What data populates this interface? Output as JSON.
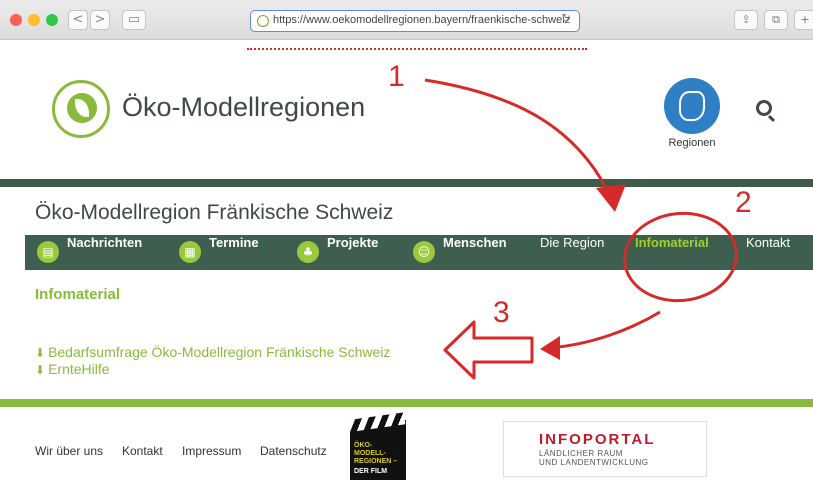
{
  "browser": {
    "url": "https://www.oekomodellregionen.bayern/fraenkische-schweiz",
    "back_glyph": "<",
    "forward_glyph": ">",
    "reload_glyph": "↻"
  },
  "header": {
    "site_title": "Öko-Modellregionen",
    "regions_label": "Regionen"
  },
  "region_title": "Öko-Modellregion Fränkische Schweiz",
  "nav": {
    "items": [
      {
        "label": "Nachrichten",
        "icon": "newspaper-icon"
      },
      {
        "label": "Termine",
        "icon": "calendar-icon"
      },
      {
        "label": "Projekte",
        "icon": "sprout-icon"
      },
      {
        "label": "Menschen",
        "icon": "people-icon"
      },
      {
        "label": "Die Region"
      },
      {
        "label": "Infomaterial",
        "active": true
      },
      {
        "label": "Kontakt"
      }
    ]
  },
  "content": {
    "heading": "Infomaterial",
    "downloads": [
      "Bedarfsumfrage Öko-Modellregion Fränkische Schweiz",
      "ErnteHilfe"
    ]
  },
  "footer": {
    "links": [
      "Wir über uns",
      "Kontakt",
      "Impressum",
      "Datenschutz"
    ],
    "film_title": "ÖKO-MODELL-REGIONEN –",
    "film_sub": "DER FILM",
    "infoportal_title": "INFOPORTAL",
    "infoportal_line1": "LÄNDLICHER RAUM",
    "infoportal_line2": "UND LANDENTWICKLUNG"
  },
  "annotations": {
    "step1": "1",
    "step2": "2",
    "step3": "3",
    "color": "#d52a2a"
  },
  "colors": {
    "brand_green": "#8aba3c",
    "nav_dark_green": "#3e5f4f",
    "active_nav": "#a2cf2f",
    "regions_blue": "#2e7fc3"
  }
}
